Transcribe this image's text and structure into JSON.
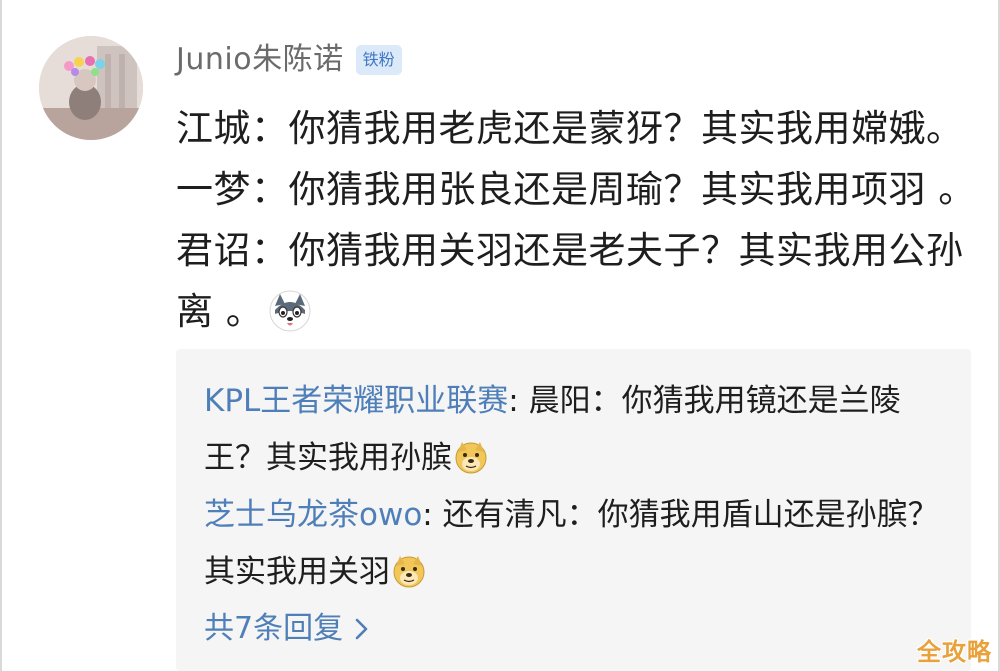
{
  "comment": {
    "username": "Junio朱陈诺",
    "badge": "铁粉",
    "text": "江城：你猜我用老虎还是蒙犽？其实我用嫦娥。一梦：你猜我用张良还是周瑜？其实我用项羽 。君诏：你猜我用关羽还是老夫子？其实我用公孙离 。",
    "emoji_icon": "husky-emoji"
  },
  "replies": [
    {
      "author": "KPL王者荣耀职业联赛",
      "text": ": 晨阳：你猜我用镜还是兰陵王？其实我用孙膑",
      "emoji_icon": "doge-emoji"
    },
    {
      "author": "芝士乌龙茶owo",
      "text": ": 还有清凡：你猜我用盾山还是孙膑？其实我用关羽",
      "emoji_icon": "doge-emoji"
    }
  ],
  "more_replies": {
    "label": "共7条回复",
    "icon": "chevron-right-icon"
  },
  "watermark": "全攻略",
  "colors": {
    "link": "#4f7fb8",
    "badge_bg": "#dce9f8",
    "badge_text": "#3f78c4",
    "reply_bg": "#f5f5f5",
    "watermark": "#e9a23b"
  }
}
